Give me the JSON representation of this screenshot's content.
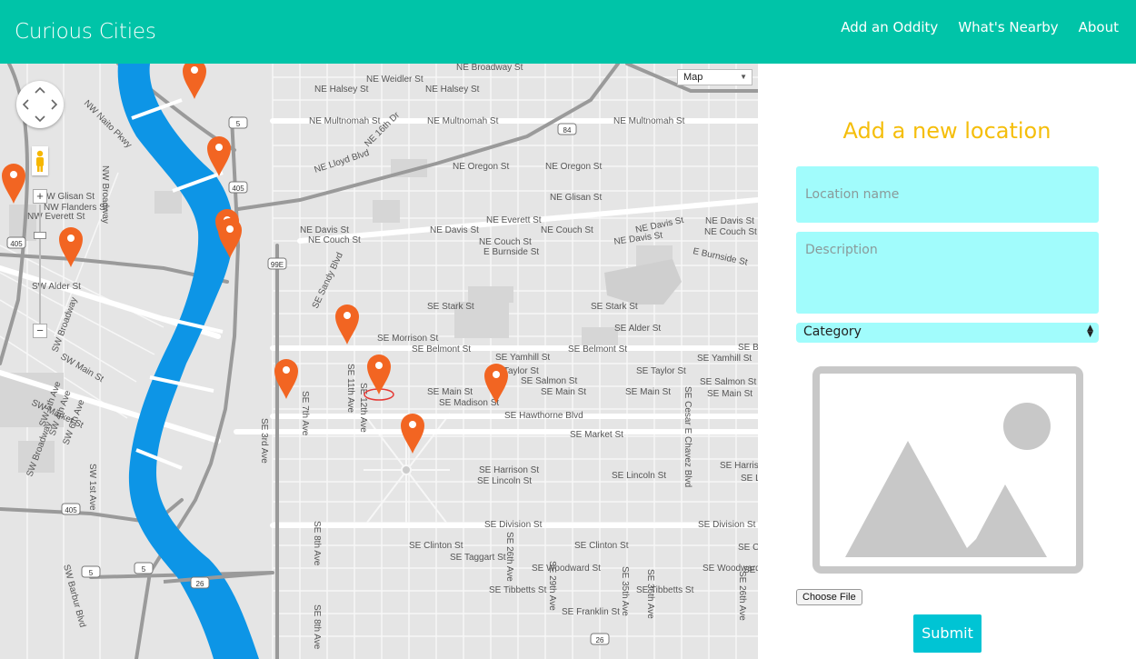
{
  "header": {
    "brand": "Curious Cities",
    "nav": [
      {
        "label": "Add an Oddity"
      },
      {
        "label": "What's Nearby"
      },
      {
        "label": "About"
      }
    ]
  },
  "map": {
    "map_type": "Map",
    "zoom_in": "+",
    "zoom_out": "−",
    "river_color": "#0d95e6",
    "marker_color": "#f26522",
    "street_labels": [
      "NE Broadway St",
      "NE Weidler St",
      "NE Halsey St",
      "NE Halsey St",
      "NE Multnomah St",
      "NE Multnomah St",
      "NE Multnomah St",
      "NE 16th Dr",
      "NE Lloyd Blvd",
      "NE Oregon St",
      "NE Oregon St",
      "NE Glisan St",
      "NE Davis St",
      "NE Everett St",
      "NE Davis St",
      "NE Couch St",
      "NE Davis St",
      "NE Couch St",
      "E Burnside St",
      "NE Davis St",
      "NE Couch St",
      "NE Davis St",
      "NE Couch St",
      "E Burnside St",
      "SE Stark St",
      "SE Stark St",
      "SE Alder St",
      "SE Morrison St",
      "SE Belmont St",
      "SE Belmont St",
      "SE Belm",
      "SE Yamhill St",
      "SE Yamhill St",
      "SE Taylor St",
      "SE Taylor St",
      "SE Salmon St",
      "SE Salmon St",
      "SE Main St",
      "SE Main St",
      "SE Main St",
      "SE Main St",
      "SE Madison St",
      "SE Hawthorne Blvd",
      "SE Market St",
      "SE Harrison St",
      "SE Harris",
      "SE Lincoln St",
      "SE Lincoln St",
      "SE Li",
      "SE Division St",
      "SE Division St",
      "SE Clinton St",
      "SE Clinton St",
      "SE Clint",
      "SE Taggart St",
      "SE Woodward St",
      "SE Woodward St",
      "SE Woodw",
      "SE Tibbetts St",
      "SE Tibbetts St",
      "SE Franklin St",
      "SE Sandy Blvd",
      "SE 7th Ave",
      "SE 11th Ave",
      "SE 12th Ave",
      "SE 3rd Ave",
      "SE Cesar E Chavez Blvd",
      "SE 8th Ave",
      "SE 8th Ave",
      "SE 26th Ave",
      "SE 29th Ave",
      "SE 35th Ave",
      "SE 36th Ave",
      "SE 26th Ave",
      "NW Naito Pkwy",
      "NW Broadway",
      "NW Glisan St",
      "NW Flanders St",
      "NW Everett St",
      "SW Alder St",
      "SW Broadway",
      "SW Main St",
      "SW Market St",
      "SW Broadway",
      "SW 5th Ave",
      "SW 4th Ave",
      "SW 6th Ave",
      "SW 1st Ave",
      "SW Barbur Blvd",
      "405",
      "405",
      "405",
      "5",
      "5",
      "5",
      "84",
      "99E",
      "26",
      "26"
    ]
  },
  "form": {
    "title": "Add a new location",
    "name_placeholder": "Location name",
    "description_placeholder": "Description",
    "category_selected": "Category",
    "file_button": "Choose File",
    "submit_label": "Submit"
  }
}
